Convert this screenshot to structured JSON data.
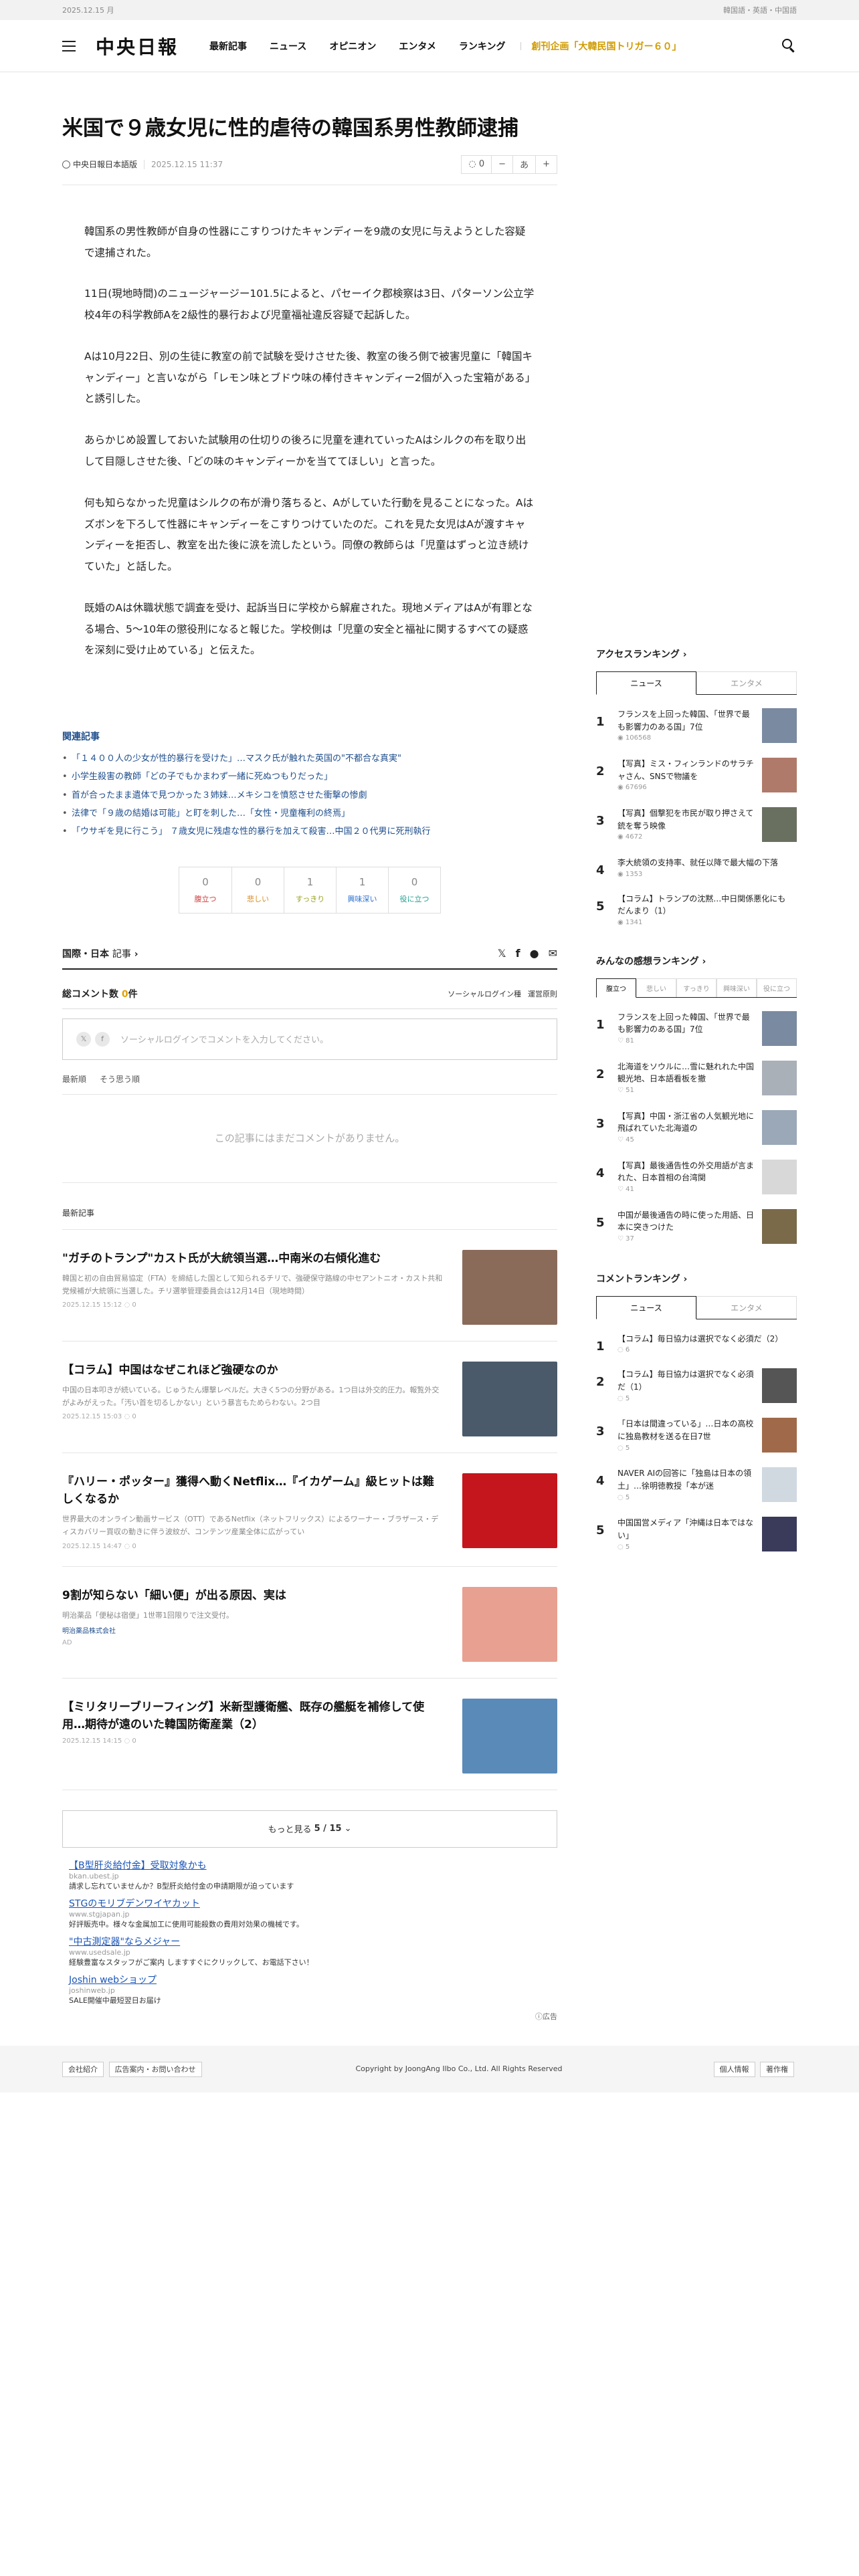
{
  "topbar": {
    "date": "2025.12.15 月",
    "languages": "韓国語・英語・中国語"
  },
  "header": {
    "logo": "中央日報",
    "nav": [
      "最新記事",
      "ニュース",
      "オピニオン",
      "エンタメ",
      "ランキング"
    ],
    "special": "創刊企画「大韓民国トリガー６０」"
  },
  "article": {
    "headline": "米国で９歳女児に性的虐待の韓国系男性教師逮捕",
    "source": "中央日報日本語版",
    "date": "2025.12.15 11:37",
    "comment_count": "0",
    "font_label": "あ",
    "paragraphs": [
      "韓国系の男性教師が自身の性器にこすりつけたキャンディーを9歳の女児に与えようとした容疑で逮捕された。",
      "11日(現地時間)のニュージャージー101.5によると、パセーイク郡検察は3日、パターソン公立学校4年の科学教師Aを2級性的暴行および児童福祉違反容疑で起訴した。",
      "Aは10月22日、別の生徒に教室の前で試験を受けさせた後、教室の後ろ側で被害児童に「韓国キャンディー」と言いながら「レモン味とブドウ味の棒付きキャンディー2個が入った宝箱がある」と誘引した。",
      "あらかじめ設置しておいた試験用の仕切りの後ろに児童を連れていったAはシルクの布を取り出して目隠しさせた後、「どの味のキャンディーかを当ててほしい」と言った。",
      "何も知らなかった児童はシルクの布が滑り落ちると、Aがしていた行動を見ることになった。Aはズボンを下ろして性器にキャンディーをこすりつけていたのだ。これを見た女児はAが渡すキャンディーを拒否し、教室を出た後に涙を流したという。同僚の教師らは「児童はずっと泣き続けていた」と話した。",
      "既婚のAは休職状態で調査を受け、起訴当日に学校から解雇された。現地メディアはAが有罪となる場合、5～10年の懲役刑になると報じた。学校側は「児童の安全と福祉に関するすべての疑惑を深刻に受け止めている」と伝えた。"
    ]
  },
  "related": {
    "title": "関連記事",
    "items": [
      "「１４００人の少女が性的暴行を受けた」…マスク氏が触れた英国の\"不都合な真実\"",
      "小学生殺害の教師「どの子でもかまわず一緒に死ぬつもりだった」",
      "首が合ったまま遺体で見つかった３姉妹…メキシコを憤怒させた衝撃の惨劇",
      "法律で「９歳の結婚は可能」と盯を刺した…「女性・児童権利の終焉」",
      "「ウサギを見に行こう」 ７歳女児に残虐な性的暴行を加えて殺害…中国２０代男に死刑執行"
    ]
  },
  "reactions": [
    {
      "label": "腹立つ",
      "count": "0",
      "color": "#d23b3b"
    },
    {
      "label": "悲しい",
      "count": "0",
      "color": "#d98c1f"
    },
    {
      "label": "すっきり",
      "count": "1",
      "color": "#9aa21a"
    },
    {
      "label": "興味深い",
      "count": "1",
      "color": "#2a6fcf"
    },
    {
      "label": "役に立つ",
      "count": "0",
      "color": "#1f9f8f"
    }
  ],
  "section": {
    "title": "国際・日本",
    "suffix": "記事"
  },
  "comments": {
    "label": "総コメント数",
    "count": "0",
    "suffix": "件",
    "login": "ソーシャルログイン種",
    "rules": "運営原則",
    "placeholder": "ソーシャルログインでコメントを入力してください。",
    "sort": [
      "最新順",
      "そう思う順"
    ],
    "empty": "この記事にはまだコメントがありません。"
  },
  "latest": {
    "label": "最新記事",
    "items": [
      {
        "title": "\"ガチのトランプ\"カスト氏が大統領当選…中南米の右傾化進む",
        "desc": "韓国と初の自由貿易協定（FTA）を締結した国として知られるチリで、強硬保守路線の中セアントニオ・カスト共和党候補が大統領に当選した。チリ選挙管理委員会は12月14日（現地時間）",
        "date": "2025.12.15 15:12",
        "comments": "0",
        "thumb_color": "#8a6b5a"
      },
      {
        "title": "【コラム】中国はなぜこれほど強硬なのか",
        "desc": "中国の日本叩きが続いている。じゅうたん爆撃レベルだ。大きく5つの分野がある。1つ目は外交的圧力。報覧外交がよみがえった。「汚い首を切るしかない」という暴言もためらわない。2つ目",
        "date": "2025.12.15 15:03",
        "comments": "0",
        "thumb_color": "#4a5a6a"
      },
      {
        "title": "『ハリー・ポッター』獲得へ動くNetflix…『イカゲーム』級ヒットは難しくなるか",
        "desc": "世界最大のオンライン動画サービス（OTT）であるNetflix（ネットフリックス）によるワーナー・ブラザース・ディスカバリー買収の動きに伴う波紋が、コンテンツ産業全体に広がってい",
        "date": "2025.12.15 14:47",
        "comments": "0",
        "thumb_color": "#c4161c"
      },
      {
        "title": "9割が知らない「細い便」が出る原因、実は",
        "desc": "明治薬品「便秘は宿便」1世帯1回限りで注文受付。",
        "advertiser": "明治薬品株式会社",
        "ad_label": "AD",
        "thumb_color": "#e8a090"
      },
      {
        "title": "【ミリタリーブリーフィング】米新型護衛艦、既存の艦艇を補修して使用…期待が遠のいた韓国防衛産業（2）",
        "date": "2025.12.15 14:15",
        "comments": "0",
        "thumb_color": "#5a8ab8"
      }
    ],
    "more": "もっと見る",
    "page": "5 / 15"
  },
  "ads": [
    {
      "title": "【B型肝炎給付金】受取対象かも",
      "url": "bkan.ubest.jp",
      "desc": "請求し忘れていませんか？B型肝炎給付金の申請期限が迫っています"
    },
    {
      "title": "STGのモリブデンワイヤカット",
      "url": "www.stgjapan.jp",
      "desc": "好評販売中。様々な金属加工に使用可能殺数の費用対効果の機械です。"
    },
    {
      "title": "\"中古測定器\"ならメジャー",
      "url": "www.usedsale.jp",
      "desc": "経験豊富なスタッフがご案内 しますすぐにクリックして、お電話下さい！"
    },
    {
      "title": "Joshin webショップ",
      "url": "joshinweb.jp",
      "desc": "SALE開催中最短翌日お届け"
    }
  ],
  "ads_footer": "ⓘ広告",
  "access_ranking": {
    "title": "アクセスランキング",
    "tabs": [
      "ニュース",
      "エンタメ"
    ],
    "items": [
      {
        "no": "1",
        "title": "フランスを上回った韓国、「世界で最も影響力のある国」7位",
        "views": "106568",
        "thumb_color": "#7a8aa0"
      },
      {
        "no": "2",
        "title": "【写真】ミス・フィンランドのサラチャさん、SNSで物議を",
        "views": "67696",
        "thumb_color": "#b07a6a"
      },
      {
        "no": "3",
        "title": "【写真】個撃犯を市民が取り押さえて銃を奪う映像",
        "views": "4672",
        "thumb_color": "#6a7060"
      },
      {
        "no": "4",
        "title": "李大統領の支持率、就任以降で最大幅の下落",
        "views": "1353",
        "thumb_color": ""
      },
      {
        "no": "5",
        "title": "【コラム】トランプの沈黙…中日関係悪化にもだんまり（1）",
        "views": "1341",
        "thumb_color": ""
      }
    ]
  },
  "feeling_ranking": {
    "title": "みんなの感想ランキング",
    "tabs": [
      "腹立つ",
      "悲しい",
      "すっきり",
      "興味深い",
      "役に立つ"
    ],
    "items": [
      {
        "no": "1",
        "title": "フランスを上回った韓国、「世界で最も影響力のある国」7位",
        "count": "81",
        "thumb_color": "#7a8aa0"
      },
      {
        "no": "2",
        "title": "北海道をソウルに…雪に魅れれた中国観光地、日本語看板を撤",
        "count": "51",
        "thumb_color": "#aab0b8"
      },
      {
        "no": "3",
        "title": "【写真】中国・浙江省の人気観光地に飛ばれていた北海道の",
        "count": "45",
        "thumb_color": "#9aa8b8"
      },
      {
        "no": "4",
        "title": "【写真】最後通告性の外交用語が言まれた、日本首相の台湾関",
        "count": "41",
        "thumb_color": "#d8d8d8"
      },
      {
        "no": "5",
        "title": "中国が最後通告の時に使った用語、日本に突きつけた",
        "count": "37",
        "thumb_color": "#7a6a4a"
      }
    ]
  },
  "comment_ranking": {
    "title": "コメントランキング",
    "tabs": [
      "ニュース",
      "エンタメ"
    ],
    "items": [
      {
        "no": "1",
        "title": "【コラム】毎日協力は選択でなく必須だ（2）",
        "count": "6",
        "thumb_color": ""
      },
      {
        "no": "2",
        "title": "【コラム】毎日協力は選択でなく必須だ（1）",
        "count": "5",
        "thumb_color": "#555555"
      },
      {
        "no": "3",
        "title": "「日本は間違っている」…日本の高校に独島教材を送る在日7世",
        "count": "5",
        "thumb_color": "#a06a4a"
      },
      {
        "no": "4",
        "title": "NAVER AIの回答に「独島は日本の領土」…徐明徳教授「本が迷",
        "count": "5",
        "thumb_color": "#d0d8e0"
      },
      {
        "no": "5",
        "title": "中国国営メディア「沖縄は日本ではない」",
        "count": "5",
        "thumb_color": "#3a3a5a"
      }
    ]
  },
  "footer": {
    "left": [
      "会社紹介",
      "広告案内・お問い合わせ"
    ],
    "copyright": "Copyright by JoongAng Ilbo Co., Ltd. All Rights Reserved",
    "right": [
      "個人情報",
      "著作権"
    ]
  }
}
